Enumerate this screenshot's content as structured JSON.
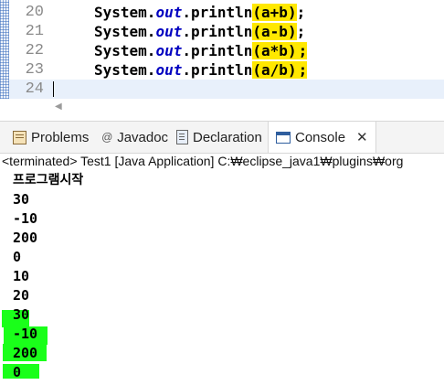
{
  "editor": {
    "lines": [
      {
        "num": "20",
        "pre": "System.",
        "out": "out",
        "mid": ".println",
        "arg": "(a+b)",
        "post": ";"
      },
      {
        "num": "21",
        "pre": "System.",
        "out": "out",
        "mid": ".println",
        "arg": "(a-b)",
        "post": ";"
      },
      {
        "num": "22",
        "pre": "System.",
        "out": "out",
        "mid": ".println",
        "arg": "(a*b)",
        "post": ";"
      },
      {
        "num": "23",
        "pre": "System.",
        "out": "out",
        "mid": ".println",
        "arg": "(a/b)",
        "post": ";"
      }
    ],
    "current_line_num": "24"
  },
  "tabs": {
    "problems": "Problems",
    "javadoc": "Javadoc",
    "javadoc_icon": "@",
    "declaration": "Declaration",
    "console": "Console",
    "close": "✕"
  },
  "console": {
    "status": "<terminated> Test1 [Java Application] C:₩eclipse_java1₩plugins₩org",
    "output": [
      "프로그램시작",
      "30",
      "-10",
      "200",
      "0",
      "10",
      "20",
      "30",
      "-10",
      "200",
      "0"
    ]
  },
  "icons": {
    "problems": "problems-icon",
    "javadoc": "javadoc-icon",
    "declaration": "declaration-icon",
    "console": "console-icon",
    "close": "close-icon"
  },
  "colors": {
    "highlight_yellow": "#ffe800",
    "marker_green": "#1aff1a",
    "static_field_blue": "#0000c0"
  }
}
